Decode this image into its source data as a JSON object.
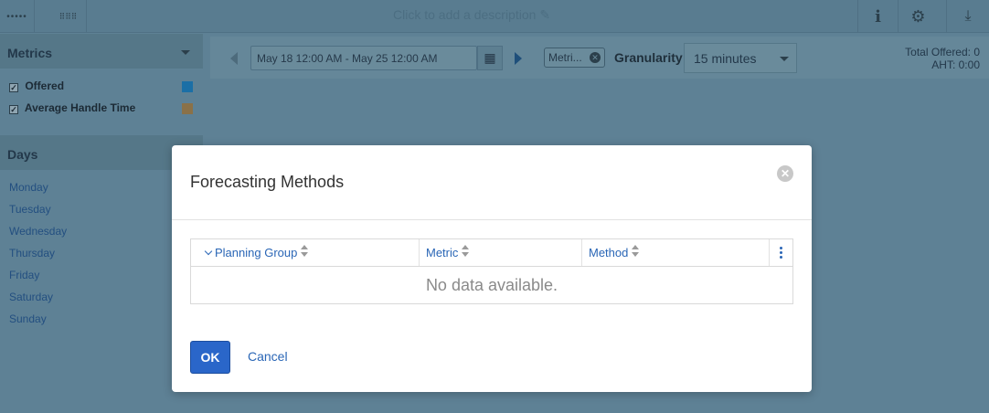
{
  "topbar": {
    "description_placeholder": "Click to add a description",
    "edit_icon": "pencil-icon",
    "info_icon": "info-icon",
    "settings_icon": "gear-icon",
    "download_icon": "download-icon"
  },
  "sidebar": {
    "metrics_title": "Metrics",
    "metrics": [
      {
        "label": "Offered",
        "checked": true,
        "color": "#1b6fa6"
      },
      {
        "label": "Average Handle Time",
        "checked": true,
        "color": "#8a7148"
      }
    ],
    "days_title": "Days",
    "days": [
      "Monday",
      "Tuesday",
      "Wednesday",
      "Thursday",
      "Friday",
      "Saturday",
      "Sunday"
    ]
  },
  "toolbar": {
    "date_range": "May 18 12:00 AM - May 25 12:00 AM",
    "metric_pill": "Metri...",
    "granularity_label": "Granularity",
    "granularity_value": "15 minutes",
    "total_offered": "Total Offered: 0",
    "aht": "AHT: 0:00"
  },
  "modal": {
    "title": "Forecasting Methods",
    "columns": [
      "Planning Group",
      "Metric",
      "Method"
    ],
    "empty_text": "No data available.",
    "ok_label": "OK",
    "cancel_label": "Cancel"
  }
}
